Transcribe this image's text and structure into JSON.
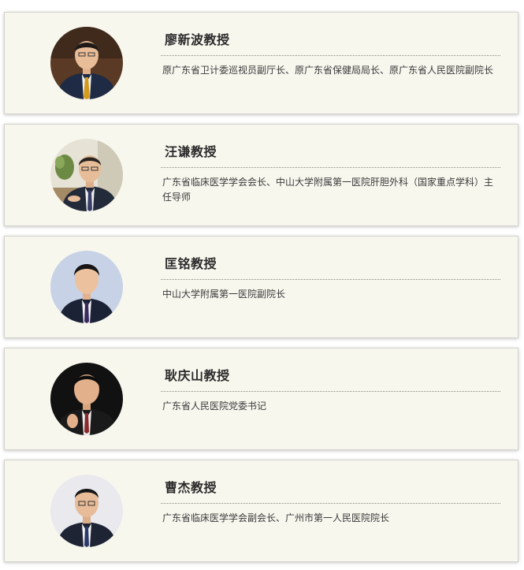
{
  "profiles": [
    {
      "name": "廖新波教授",
      "description": "原广东省卫计委巡视员副厅长、原广东省保健局局长、原广东省人民医院副院长"
    },
    {
      "name": "汪谦教授",
      "description": "广东省临床医学学会会长、中山大学附属第一医院肝胆外科（国家重点学科）主任导师"
    },
    {
      "name": "匡铭教授",
      "description": "中山大学附属第一医院副院长"
    },
    {
      "name": "耿庆山教授",
      "description": "广东省人民医院党委书记"
    },
    {
      "name": "曹杰教授",
      "description": "广东省临床医学学会副会长、广州市第一人民医院院长"
    }
  ]
}
